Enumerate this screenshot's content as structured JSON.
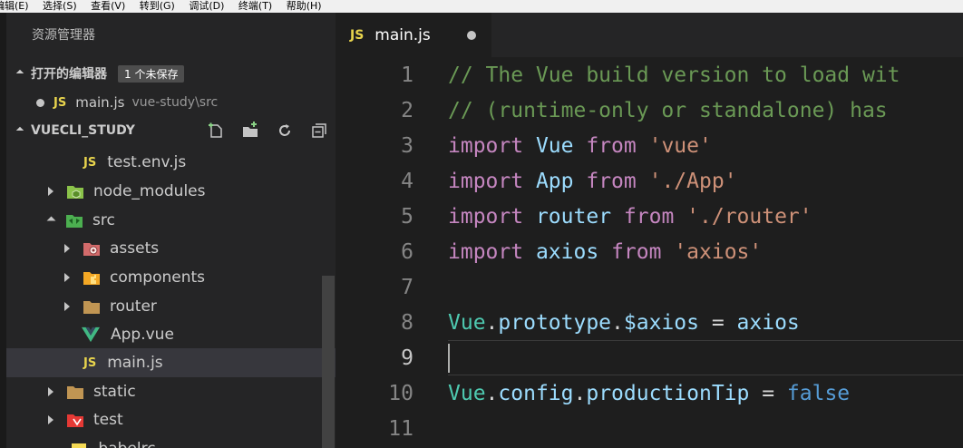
{
  "menu": [
    "编辑(E)",
    "选择(S)",
    "查看(V)",
    "转到(G)",
    "调试(D)",
    "终端(T)",
    "帮助(H)"
  ],
  "explorer": {
    "title": "资源管理器",
    "open_editors": {
      "label": "打开的编辑器",
      "badge": "1 个未保存",
      "file": {
        "icon": "JS",
        "name": "main.js",
        "path": "vue-study\\src"
      }
    },
    "project": {
      "label": "VUECLI_STUDY",
      "tree": [
        {
          "label": "test.env.js",
          "icon": "js-file-icon",
          "glyph": "JS"
        },
        {
          "label": "node_modules",
          "icon": "node-folder-icon"
        },
        {
          "label": "src",
          "icon": "src-folder-icon"
        },
        {
          "label": "assets",
          "icon": "assets-folder-icon"
        },
        {
          "label": "components",
          "icon": "components-folder-icon"
        },
        {
          "label": "router",
          "icon": "folder-icon"
        },
        {
          "label": "App.vue",
          "icon": "vue-file-icon"
        },
        {
          "label": "main.js",
          "icon": "js-file-icon",
          "glyph": "JS"
        },
        {
          "label": "static",
          "icon": "folder-icon"
        },
        {
          "label": "test",
          "icon": "test-folder-icon"
        },
        {
          "label": ".babelrc",
          "icon": "babel-file-icon"
        }
      ]
    }
  },
  "tab": {
    "icon": "JS",
    "label": "main.js",
    "dirty": true
  },
  "editor": {
    "line_numbers": [
      "1",
      "2",
      "3",
      "4",
      "5",
      "6",
      "7",
      "8",
      "9",
      "10",
      "11"
    ],
    "active_line": "9",
    "lines": [
      [
        {
          "t": "// The Vue build version to load wit",
          "c": "comment"
        }
      ],
      [
        {
          "t": "// (runtime-only or standalone) has",
          "c": "comment"
        }
      ],
      [
        {
          "t": "import",
          "c": "kw"
        },
        {
          "t": " ",
          "c": "op"
        },
        {
          "t": "Vue",
          "c": "id"
        },
        {
          "t": " ",
          "c": "op"
        },
        {
          "t": "from",
          "c": "kw"
        },
        {
          "t": " ",
          "c": "op"
        },
        {
          "t": "'vue'",
          "c": "str"
        }
      ],
      [
        {
          "t": "import",
          "c": "kw"
        },
        {
          "t": " ",
          "c": "op"
        },
        {
          "t": "App",
          "c": "id"
        },
        {
          "t": " ",
          "c": "op"
        },
        {
          "t": "from",
          "c": "kw"
        },
        {
          "t": " ",
          "c": "op"
        },
        {
          "t": "'./App'",
          "c": "str"
        }
      ],
      [
        {
          "t": "import",
          "c": "kw"
        },
        {
          "t": " ",
          "c": "op"
        },
        {
          "t": "router",
          "c": "id"
        },
        {
          "t": " ",
          "c": "op"
        },
        {
          "t": "from",
          "c": "kw"
        },
        {
          "t": " ",
          "c": "op"
        },
        {
          "t": "'./router'",
          "c": "str"
        }
      ],
      [
        {
          "t": "import",
          "c": "kw"
        },
        {
          "t": " ",
          "c": "op"
        },
        {
          "t": "axios",
          "c": "id"
        },
        {
          "t": " ",
          "c": "op"
        },
        {
          "t": "from",
          "c": "kw"
        },
        {
          "t": " ",
          "c": "op"
        },
        {
          "t": "'axios'",
          "c": "str"
        }
      ],
      [],
      [
        {
          "t": "Vue",
          "c": "cls"
        },
        {
          "t": ".",
          "c": "op"
        },
        {
          "t": "prototype",
          "c": "id"
        },
        {
          "t": ".",
          "c": "op"
        },
        {
          "t": "$axios",
          "c": "id"
        },
        {
          "t": " = ",
          "c": "op"
        },
        {
          "t": "axios",
          "c": "id"
        }
      ],
      [],
      [
        {
          "t": "Vue",
          "c": "cls"
        },
        {
          "t": ".",
          "c": "op"
        },
        {
          "t": "config",
          "c": "id"
        },
        {
          "t": ".",
          "c": "op"
        },
        {
          "t": "productionTip",
          "c": "id"
        },
        {
          "t": " = ",
          "c": "op"
        },
        {
          "t": "false",
          "c": "bool"
        }
      ],
      []
    ]
  },
  "colors": {
    "sidebar_bg": "#252526",
    "editor_bg": "#1e1e1e",
    "selection_bg": "#37373d",
    "comment": "#6a9955",
    "keyword": "#c586c0",
    "identifier": "#9cdcfe",
    "class": "#4ec9b0",
    "string": "#ce9178",
    "boolean": "#569cd6"
  }
}
